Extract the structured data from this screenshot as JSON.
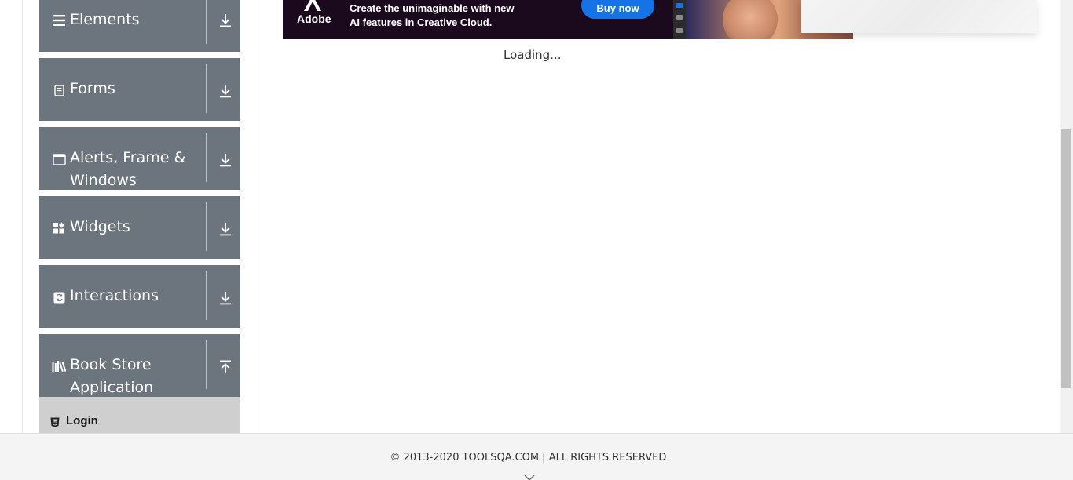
{
  "sidebar": {
    "groups": [
      {
        "title": "Elements",
        "icon": "hamburger-icon",
        "toggle": "download-arrow-icon"
      },
      {
        "title": "Forms",
        "icon": "document-icon",
        "toggle": "download-arrow-icon"
      },
      {
        "title": "Alerts, Frame & Windows",
        "icon": "window-icon",
        "toggle": "download-arrow-icon"
      },
      {
        "title": "Widgets",
        "icon": "widgets-icon",
        "toggle": "download-arrow-icon"
      },
      {
        "title": "Interactions",
        "icon": "interactions-icon",
        "toggle": "download-arrow-icon"
      },
      {
        "title": "Book Store Application",
        "icon": "books-icon",
        "toggle": "upload-arrow-icon"
      }
    ],
    "submenu": [
      {
        "label": "Login",
        "icon": "html5-icon"
      }
    ]
  },
  "ad": {
    "brand": "Adobe",
    "line1": "Create the unimaginable with new",
    "line2": "AI features in Creative Cloud.",
    "cta": "Buy now"
  },
  "main": {
    "loading_text": "Loading..."
  },
  "footer": {
    "copyright": "© 2013-2020 TOOLSQA.COM | ALL RIGHTS RESERVED."
  },
  "colors": {
    "sidebar_group_bg": "#6c757d",
    "submenu_bg": "#cfcfcf",
    "ad_bg": "#1b0a1d",
    "ad_cta": "#1473e6",
    "footer_bg": "#f4f4f4"
  }
}
